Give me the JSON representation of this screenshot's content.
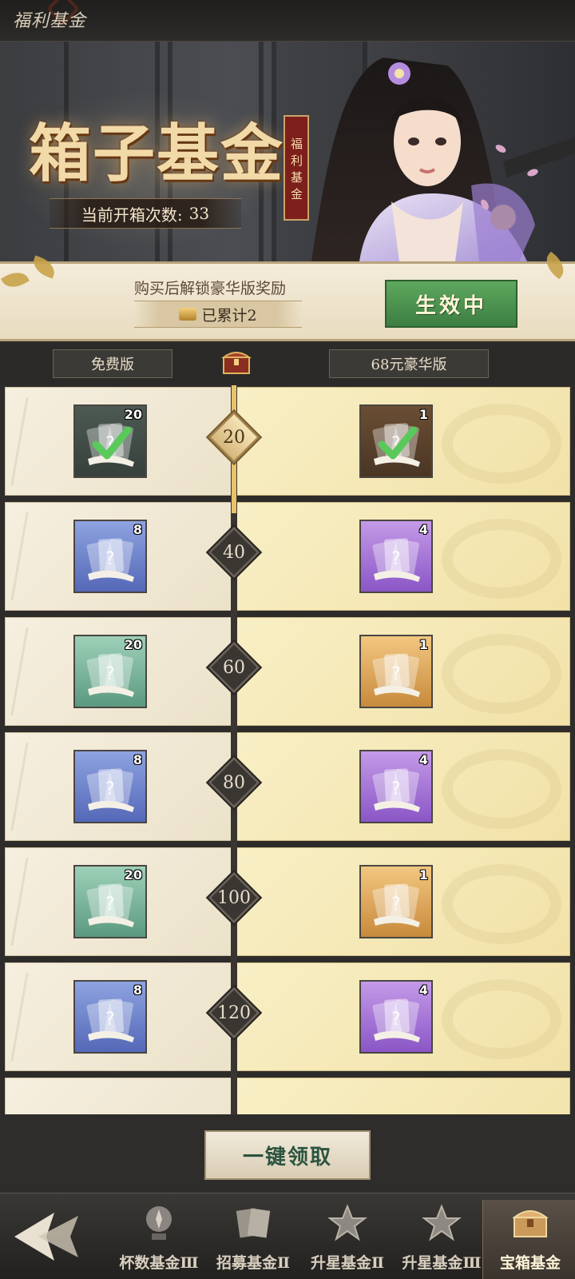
{
  "header": {
    "title": "福利基金",
    "back_icon": "back-arrow-icon"
  },
  "banner": {
    "title": "箱子基金",
    "seal_text": "福利基金",
    "open_count_label": "当前开箱次数:",
    "open_count_value": "33"
  },
  "unlock": {
    "hint": "购买后解锁豪华版奖励",
    "accumulated": "已累计2",
    "status_button": "生效中"
  },
  "columns": {
    "free": "免费版",
    "deluxe": "68元豪华版"
  },
  "rewards": [
    {
      "milestone": "20",
      "reached": true,
      "free": {
        "count": "20",
        "rarity": "green",
        "claimed": true
      },
      "deluxe": {
        "count": "1",
        "rarity": "gold",
        "claimed": true
      }
    },
    {
      "milestone": "40",
      "reached": false,
      "free": {
        "count": "8",
        "rarity": "blue",
        "claimed": false
      },
      "deluxe": {
        "count": "4",
        "rarity": "purple",
        "claimed": false
      }
    },
    {
      "milestone": "60",
      "reached": false,
      "free": {
        "count": "20",
        "rarity": "green",
        "claimed": false
      },
      "deluxe": {
        "count": "1",
        "rarity": "gold",
        "claimed": false
      }
    },
    {
      "milestone": "80",
      "reached": false,
      "free": {
        "count": "8",
        "rarity": "blue",
        "claimed": false
      },
      "deluxe": {
        "count": "4",
        "rarity": "purple",
        "claimed": false
      }
    },
    {
      "milestone": "100",
      "reached": false,
      "free": {
        "count": "20",
        "rarity": "green",
        "claimed": false
      },
      "deluxe": {
        "count": "1",
        "rarity": "gold",
        "claimed": false
      }
    },
    {
      "milestone": "120",
      "reached": false,
      "free": {
        "count": "8",
        "rarity": "blue",
        "claimed": false
      },
      "deluxe": {
        "count": "4",
        "rarity": "purple",
        "claimed": false
      }
    }
  ],
  "claim_all": "一键领取",
  "tabs": [
    {
      "label": "杯数基金Ⅲ",
      "icon": "trophy-icon",
      "active": false
    },
    {
      "label": "招募基金Ⅱ",
      "icon": "recruit-cards-icon",
      "active": false
    },
    {
      "label": "升星基金Ⅱ",
      "icon": "star-icon",
      "active": false
    },
    {
      "label": "升星基金Ⅲ",
      "icon": "star-icon",
      "active": false
    },
    {
      "label": "宝箱基金",
      "icon": "treasure-chest-icon",
      "active": true
    }
  ],
  "colors": {
    "accent_gold": "#e8c36a",
    "active_green": "#4e9553",
    "claim_text": "#2c5440"
  }
}
